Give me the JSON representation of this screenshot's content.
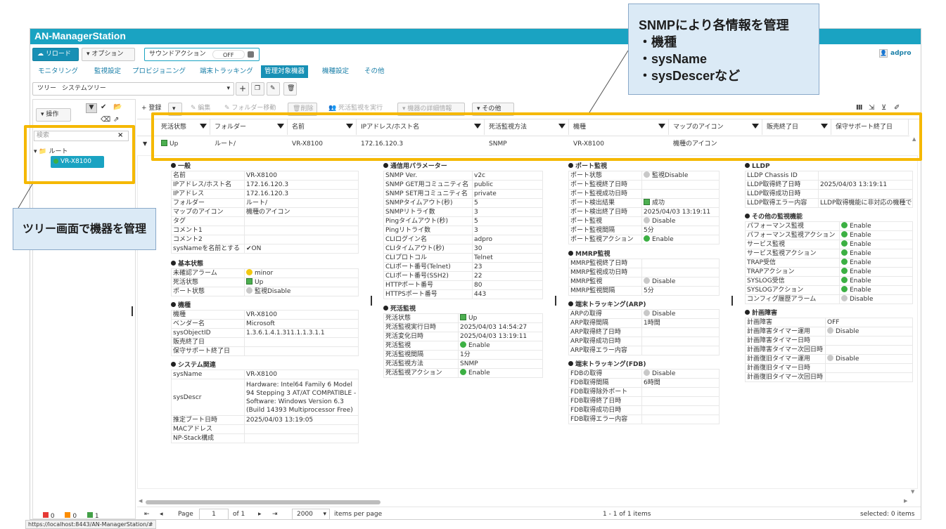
{
  "app": {
    "title": "AN-ManagerStation"
  },
  "toolbar": {
    "reload": "リロード",
    "options": "オプション",
    "sound_action": "サウンドアクション",
    "sound_state": "OFF",
    "user": "adpro"
  },
  "menu": {
    "items": [
      "モニタリング",
      "監視設定",
      "プロビジョニング",
      "端末トラッキング",
      "管理対象機器",
      "機種設定",
      "その他"
    ],
    "active": "管理対象機器"
  },
  "tree_select": {
    "label": "ツリー",
    "value": "システムツリー"
  },
  "left": {
    "ops": "操作",
    "search_placeholder": "検索",
    "root": "ルート",
    "device": "VR-X8100",
    "status_counts": [
      "0",
      "0",
      "1"
    ]
  },
  "actions": {
    "register": "登録",
    "edit": "編集",
    "move_folder": "フォルダー移動",
    "delete": "削除",
    "run_monitor": "死活監視を実行",
    "details": "機器の詳細情報",
    "other": "その他"
  },
  "grid": {
    "columns": [
      "死活状態",
      "フォルダー",
      "名前",
      "IPアドレス/ホスト名",
      "死活監視方法",
      "機種",
      "マップのアイコン",
      "販売終了日",
      "保守サポート終了日"
    ],
    "row": [
      "Up",
      "ルート/",
      "VR-X8100",
      "172.16.120.3",
      "SNMP",
      "VR-X8100",
      "機種のアイコン",
      "",
      ""
    ]
  },
  "details": {
    "general": {
      "title": "一般",
      "rows": [
        [
          "名前",
          "VR-X8100"
        ],
        [
          "IPアドレス/ホスト名",
          "172.16.120.3"
        ],
        [
          "IPアドレス",
          "172.16.120.3"
        ],
        [
          "フォルダー",
          "ルート/"
        ],
        [
          "マップのアイコン",
          "機種のアイコン"
        ],
        [
          "タグ",
          ""
        ],
        [
          "コメント1",
          ""
        ],
        [
          "コメント2",
          ""
        ],
        [
          "sysNameを名前とする",
          "✔ON"
        ]
      ]
    },
    "basic": {
      "title": "基本状態",
      "rows": [
        [
          "未確認アラーム",
          "minor"
        ],
        [
          "死活状態",
          "Up"
        ],
        [
          "ポート状態",
          "監視Disable"
        ]
      ]
    },
    "model": {
      "title": "機種",
      "rows": [
        [
          "機種",
          "VR-X8100"
        ],
        [
          "ベンダー名",
          "Microsoft"
        ],
        [
          "sysObjectID",
          "1.3.6.1.4.1.311.1.1.3.1.1"
        ],
        [
          "販売終了日",
          ""
        ],
        [
          "保守サポート終了日",
          ""
        ]
      ]
    },
    "system": {
      "title": "システム関連",
      "rows": [
        [
          "sysName",
          "VR-X8100"
        ],
        [
          "sysDescr",
          "Hardware: Intel64 Family 6 Model 94 Stepping 3 AT/AT COMPATIBLE - Software: Windows Version 6.3 (Build 14393 Multiprocessor Free)"
        ],
        [
          "推定ブート日時",
          "2025/04/03 13:19:05"
        ],
        [
          "MACアドレス",
          ""
        ],
        [
          "NP-Stack構成",
          ""
        ]
      ]
    },
    "comm": {
      "title": "通信用パラメーター",
      "rows": [
        [
          "SNMP Ver.",
          "v2c"
        ],
        [
          "SNMP GET用コミュニティ名",
          "public"
        ],
        [
          "SNMP SET用コミュニティ名",
          "private"
        ],
        [
          "SNMPタイムアウト(秒)",
          "5"
        ],
        [
          "SNMPリトライ数",
          "3"
        ],
        [
          "Pingタイムアウト(秒)",
          "5"
        ],
        [
          "Pingリトライ数",
          "3"
        ],
        [
          "CLIログイン名",
          "adpro"
        ],
        [
          "CLIタイムアウト(秒)",
          "30"
        ],
        [
          "CLIプロトコル",
          "Telnet"
        ],
        [
          "CLIポート番号(Telnet)",
          "23"
        ],
        [
          "CLIポート番号(SSH2)",
          "22"
        ],
        [
          "HTTPポート番号",
          "80"
        ],
        [
          "HTTPSポート番号",
          "443"
        ]
      ]
    },
    "alive": {
      "title": "死活監視",
      "rows": [
        [
          "死活状態",
          "Up"
        ],
        [
          "死活監視実行日時",
          "2025/04/03 14:54:27"
        ],
        [
          "死活変化日時",
          "2025/04/03 13:19:11"
        ],
        [
          "死活監視",
          "Enable"
        ],
        [
          "死活監視間隔",
          "1分"
        ],
        [
          "死活監視方法",
          "SNMP"
        ],
        [
          "死活監視アクション",
          "Enable"
        ]
      ]
    },
    "port": {
      "title": "ポート監視",
      "rows": [
        [
          "ポート状態",
          "監視Disable"
        ],
        [
          "ポート監視終了日時",
          ""
        ],
        [
          "ポート監視成功日時",
          ""
        ],
        [
          "ポート検出結果",
          "成功"
        ],
        [
          "ポート検出終了日時",
          "2025/04/03 13:19:11"
        ],
        [
          "ポート監視",
          "Disable"
        ],
        [
          "ポート監視間隔",
          "5分"
        ],
        [
          "ポート監視アクション",
          "Enable"
        ]
      ]
    },
    "mmrp": {
      "title": "MMRP監視",
      "rows": [
        [
          "MMRP監視終了日時",
          ""
        ],
        [
          "MMRP監視成功日時",
          ""
        ],
        [
          "MMRP監視",
          "Disable"
        ],
        [
          "MMRP監視間隔",
          "5分"
        ]
      ]
    },
    "arp": {
      "title": "端末トラッキング(ARP)",
      "rows": [
        [
          "ARPの取得",
          "Disable"
        ],
        [
          "ARP取得間隔",
          "1時間"
        ],
        [
          "ARP取得終了日時",
          ""
        ],
        [
          "ARP取得成功日時",
          ""
        ],
        [
          "ARP取得エラー内容",
          ""
        ]
      ]
    },
    "fdb": {
      "title": "端末トラッキング(FDB)",
      "rows": [
        [
          "FDBの取得",
          "Disable"
        ],
        [
          "FDB取得間隔",
          "6時間"
        ],
        [
          "FDB取得除外ポート",
          ""
        ],
        [
          "FDB取得終了日時",
          ""
        ],
        [
          "FDB取得成功日時",
          ""
        ],
        [
          "FDB取得エラー内容",
          ""
        ]
      ]
    },
    "lldp": {
      "title": "LLDP",
      "rows": [
        [
          "LLDP Chassis ID",
          ""
        ],
        [
          "LLDP取得終了日時",
          "2025/04/03 13:19:11"
        ],
        [
          "LLDP取得成功日時",
          ""
        ],
        [
          "LLDP取得エラー内容",
          "LLDP取得機能に非対応の機種で"
        ]
      ]
    },
    "othermon": {
      "title": "その他の監視機能",
      "rows": [
        [
          "パフォーマンス監視",
          "Enable"
        ],
        [
          "パフォーマンス監視アクション",
          "Enable"
        ],
        [
          "サービス監視",
          "Enable"
        ],
        [
          "サービス監視アクション",
          "Enable"
        ],
        [
          "TRAP受信",
          "Enable"
        ],
        [
          "TRAPアクション",
          "Enable"
        ],
        [
          "SYSLOG受信",
          "Enable"
        ],
        [
          "SYSLOGアクション",
          "Enable"
        ],
        [
          "コンフィグ履歴アラーム",
          "Disable"
        ]
      ]
    },
    "plan": {
      "title": "計画障害",
      "rows": [
        [
          "計画障害",
          "OFF"
        ],
        [
          "計画障害タイマー運用",
          "Disable"
        ],
        [
          "計画障害タイマー日時",
          ""
        ],
        [
          "計画障害タイマー次回日時",
          ""
        ],
        [
          "計画復旧タイマー運用",
          "Disable"
        ],
        [
          "計画復旧タイマー日時",
          ""
        ],
        [
          "計画復旧タイマー次回日時",
          ""
        ]
      ]
    }
  },
  "pager": {
    "page_label": "Page",
    "page": "1",
    "of": "of 1",
    "size": "2000",
    "per_page": "items per page",
    "range": "1 - 1 of 1 items",
    "selected": "selected: 0 items"
  },
  "status_url": "https://localhost:8443/AN-ManagerStation/#",
  "callouts": {
    "snmp_title": "SNMPにより各情報を管理",
    "snmp_items": [
      "・機種",
      "・sysName",
      "・sysDescerなど"
    ],
    "tree": "ツリー画面で機器を管理"
  },
  "colors": {
    "accent": "#1aa3c2",
    "highlight": "#f5b800",
    "callout_bg": "#dbeaf6"
  }
}
